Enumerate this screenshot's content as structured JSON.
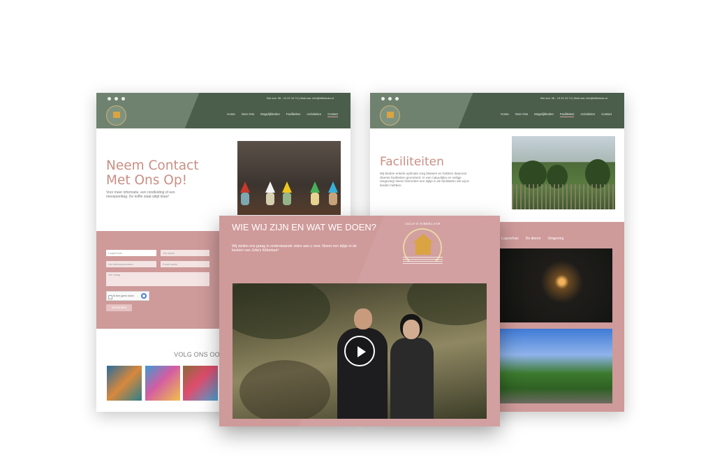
{
  "page1": {
    "contact_line": "Bel ons: 06 - 13 22 10 74  |  Mail ons: info@kfblokuto.nl",
    "nav": [
      "Home",
      "Over Ons",
      "Mogelijkheden",
      "Faciliteiten",
      "Activiteiten",
      "Contact"
    ],
    "active_nav": "Contact",
    "heading": "Neem Contact Met Ons Op!",
    "intro": "Voor meer informatie, een rondleiding of een meespeeldag. De koffie staat altijd klaar!",
    "form": {
      "select_value": "Logeerhuis",
      "name_placeholder": "Uw naam",
      "phone_placeholder": "Uw telefoonnummer",
      "email_placeholder": "Email adres",
      "message_placeholder": "Uw vraag",
      "captcha_label": "Ik ben geen robot",
      "send_label": "Verzenden"
    },
    "facebook_title": "VOLG ONS OOK OP FACEBOOK"
  },
  "page2": {
    "heading": "WIE WIJ ZIJN EN WAT WE DOEN?",
    "subtitle": "Wij stellen ons graag in onderstaande video aan u voor. Neem een kijkje in de keuken van Julia's Kibbelaar!",
    "logo_text": "JULIA'S KIBBELAAR",
    "play_icon": "play-icon"
  },
  "page3": {
    "contact_line": "Bel ons: 06 - 13 22 10 74  |  Mail ons: info@kfblokuto.nl",
    "nav": [
      "Home",
      "Over Ons",
      "Mogelijkheden",
      "Faciliteiten",
      "Activiteiten",
      "Contact"
    ],
    "active_nav": "Faciliteiten",
    "heading": "Faciliteiten",
    "intro": "Wij bieden enkele optimale zorg blassen en hebben daarvoor diverse faciliteiten gecreëerd. In een natuurlijke en veilige omgeving! Neem hieronder een kijkje in de faciliteiten die wij te bieden hebben.",
    "tabs": [
      "Logeerhuis",
      "De dieren",
      "Omgeving"
    ]
  },
  "colors": {
    "header_green": "#4a5e4b",
    "accent_pink": "#cf9a9a",
    "heading_rose": "#c98f84"
  }
}
